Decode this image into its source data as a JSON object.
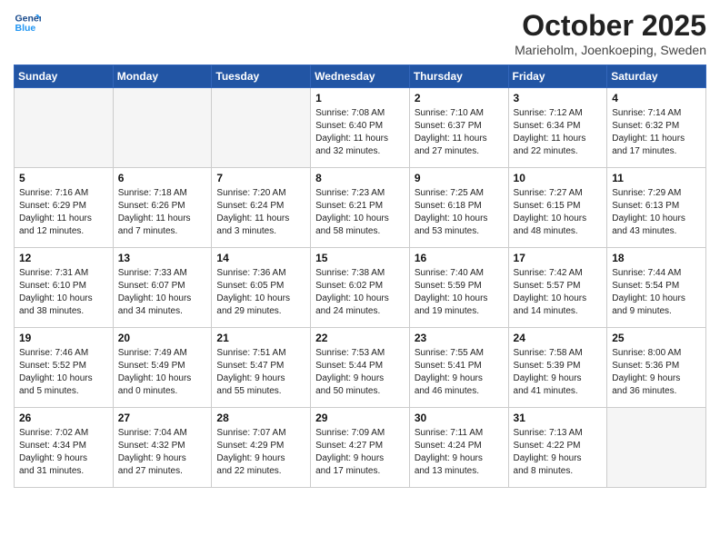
{
  "logo": {
    "line1": "General",
    "line2": "Blue"
  },
  "title": "October 2025",
  "subtitle": "Marieholm, Joenkoeping, Sweden",
  "days_of_week": [
    "Sunday",
    "Monday",
    "Tuesday",
    "Wednesday",
    "Thursday",
    "Friday",
    "Saturday"
  ],
  "weeks": [
    [
      {
        "day": "",
        "info": ""
      },
      {
        "day": "",
        "info": ""
      },
      {
        "day": "",
        "info": ""
      },
      {
        "day": "1",
        "info": "Sunrise: 7:08 AM\nSunset: 6:40 PM\nDaylight: 11 hours\nand 32 minutes."
      },
      {
        "day": "2",
        "info": "Sunrise: 7:10 AM\nSunset: 6:37 PM\nDaylight: 11 hours\nand 27 minutes."
      },
      {
        "day": "3",
        "info": "Sunrise: 7:12 AM\nSunset: 6:34 PM\nDaylight: 11 hours\nand 22 minutes."
      },
      {
        "day": "4",
        "info": "Sunrise: 7:14 AM\nSunset: 6:32 PM\nDaylight: 11 hours\nand 17 minutes."
      }
    ],
    [
      {
        "day": "5",
        "info": "Sunrise: 7:16 AM\nSunset: 6:29 PM\nDaylight: 11 hours\nand 12 minutes."
      },
      {
        "day": "6",
        "info": "Sunrise: 7:18 AM\nSunset: 6:26 PM\nDaylight: 11 hours\nand 7 minutes."
      },
      {
        "day": "7",
        "info": "Sunrise: 7:20 AM\nSunset: 6:24 PM\nDaylight: 11 hours\nand 3 minutes."
      },
      {
        "day": "8",
        "info": "Sunrise: 7:23 AM\nSunset: 6:21 PM\nDaylight: 10 hours\nand 58 minutes."
      },
      {
        "day": "9",
        "info": "Sunrise: 7:25 AM\nSunset: 6:18 PM\nDaylight: 10 hours\nand 53 minutes."
      },
      {
        "day": "10",
        "info": "Sunrise: 7:27 AM\nSunset: 6:15 PM\nDaylight: 10 hours\nand 48 minutes."
      },
      {
        "day": "11",
        "info": "Sunrise: 7:29 AM\nSunset: 6:13 PM\nDaylight: 10 hours\nand 43 minutes."
      }
    ],
    [
      {
        "day": "12",
        "info": "Sunrise: 7:31 AM\nSunset: 6:10 PM\nDaylight: 10 hours\nand 38 minutes."
      },
      {
        "day": "13",
        "info": "Sunrise: 7:33 AM\nSunset: 6:07 PM\nDaylight: 10 hours\nand 34 minutes."
      },
      {
        "day": "14",
        "info": "Sunrise: 7:36 AM\nSunset: 6:05 PM\nDaylight: 10 hours\nand 29 minutes."
      },
      {
        "day": "15",
        "info": "Sunrise: 7:38 AM\nSunset: 6:02 PM\nDaylight: 10 hours\nand 24 minutes."
      },
      {
        "day": "16",
        "info": "Sunrise: 7:40 AM\nSunset: 5:59 PM\nDaylight: 10 hours\nand 19 minutes."
      },
      {
        "day": "17",
        "info": "Sunrise: 7:42 AM\nSunset: 5:57 PM\nDaylight: 10 hours\nand 14 minutes."
      },
      {
        "day": "18",
        "info": "Sunrise: 7:44 AM\nSunset: 5:54 PM\nDaylight: 10 hours\nand 9 minutes."
      }
    ],
    [
      {
        "day": "19",
        "info": "Sunrise: 7:46 AM\nSunset: 5:52 PM\nDaylight: 10 hours\nand 5 minutes."
      },
      {
        "day": "20",
        "info": "Sunrise: 7:49 AM\nSunset: 5:49 PM\nDaylight: 10 hours\nand 0 minutes."
      },
      {
        "day": "21",
        "info": "Sunrise: 7:51 AM\nSunset: 5:47 PM\nDaylight: 9 hours\nand 55 minutes."
      },
      {
        "day": "22",
        "info": "Sunrise: 7:53 AM\nSunset: 5:44 PM\nDaylight: 9 hours\nand 50 minutes."
      },
      {
        "day": "23",
        "info": "Sunrise: 7:55 AM\nSunset: 5:41 PM\nDaylight: 9 hours\nand 46 minutes."
      },
      {
        "day": "24",
        "info": "Sunrise: 7:58 AM\nSunset: 5:39 PM\nDaylight: 9 hours\nand 41 minutes."
      },
      {
        "day": "25",
        "info": "Sunrise: 8:00 AM\nSunset: 5:36 PM\nDaylight: 9 hours\nand 36 minutes."
      }
    ],
    [
      {
        "day": "26",
        "info": "Sunrise: 7:02 AM\nSunset: 4:34 PM\nDaylight: 9 hours\nand 31 minutes."
      },
      {
        "day": "27",
        "info": "Sunrise: 7:04 AM\nSunset: 4:32 PM\nDaylight: 9 hours\nand 27 minutes."
      },
      {
        "day": "28",
        "info": "Sunrise: 7:07 AM\nSunset: 4:29 PM\nDaylight: 9 hours\nand 22 minutes."
      },
      {
        "day": "29",
        "info": "Sunrise: 7:09 AM\nSunset: 4:27 PM\nDaylight: 9 hours\nand 17 minutes."
      },
      {
        "day": "30",
        "info": "Sunrise: 7:11 AM\nSunset: 4:24 PM\nDaylight: 9 hours\nand 13 minutes."
      },
      {
        "day": "31",
        "info": "Sunrise: 7:13 AM\nSunset: 4:22 PM\nDaylight: 9 hours\nand 8 minutes."
      },
      {
        "day": "",
        "info": ""
      }
    ]
  ]
}
